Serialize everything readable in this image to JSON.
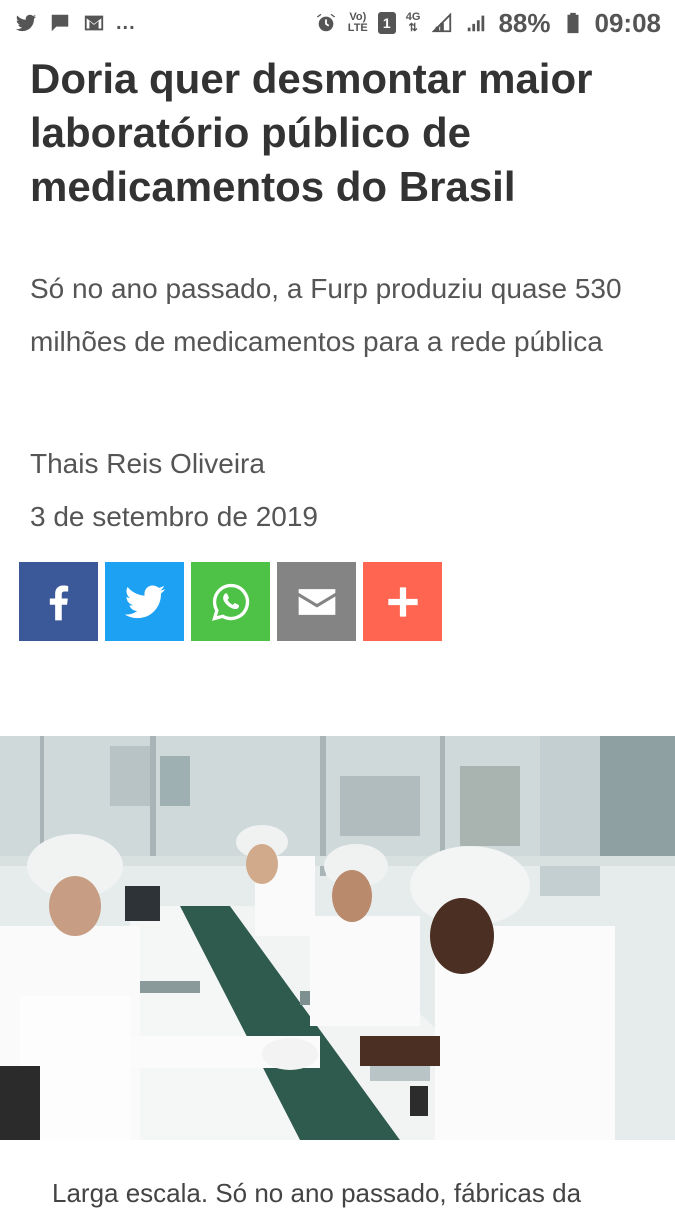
{
  "statusbar": {
    "battery": "88%",
    "time": "09:08",
    "sim": "1",
    "network": "4G",
    "volte_top": "Vo)",
    "volte_bottom": "LTE",
    "more": "..."
  },
  "article": {
    "headline": "Doria quer desmontar maior laboratório público de medicamentos do Brasil",
    "subtitle": "Só no ano passado, a Furp produziu quase 530 milhões de medicamentos para a rede pública",
    "author": "Thais Reis Oliveira",
    "date": "3 de setembro de 2019",
    "caption": "Larga escala. Só no ano passado, fábricas da"
  },
  "share_buttons": [
    {
      "name": "facebook",
      "icon": "facebook-icon",
      "color": "#3b5998"
    },
    {
      "name": "twitter",
      "icon": "twitter-icon",
      "color": "#1da1f2"
    },
    {
      "name": "whatsapp",
      "icon": "whatsapp-icon",
      "color": "#4dc247"
    },
    {
      "name": "email",
      "icon": "mail-icon",
      "color": "#848484"
    },
    {
      "name": "more",
      "icon": "plus-icon",
      "color": "#ff6550"
    }
  ]
}
